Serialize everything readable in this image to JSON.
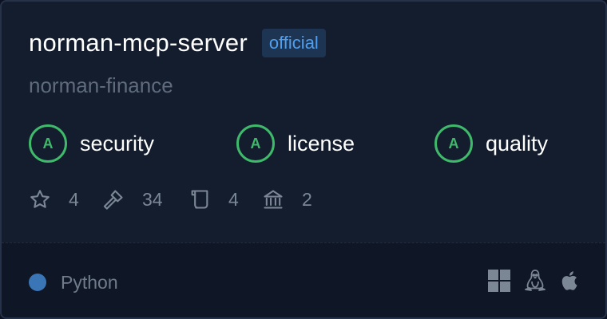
{
  "server": {
    "name": "norman-mcp-server",
    "badge": "official",
    "owner": "norman-finance"
  },
  "grades": [
    {
      "grade": "A",
      "label": "security"
    },
    {
      "grade": "A",
      "label": "license"
    },
    {
      "grade": "A",
      "label": "quality"
    }
  ],
  "stats": {
    "stars": {
      "icon": "star-icon",
      "value": "4"
    },
    "tools": {
      "icon": "hammer-icon",
      "value": "34"
    },
    "scroll": {
      "icon": "scroll-icon",
      "value": "4"
    },
    "bank": {
      "icon": "bank-icon",
      "value": "2"
    }
  },
  "footer": {
    "language": "Python",
    "language_color": "#3a75b5",
    "platforms": [
      "windows-icon",
      "linux-icon",
      "apple-icon"
    ]
  },
  "colors": {
    "card_bg": "#131d2e",
    "grade_green": "#3fb96a",
    "badge_text": "#4f9ff0",
    "muted_text": "#7c8796"
  }
}
